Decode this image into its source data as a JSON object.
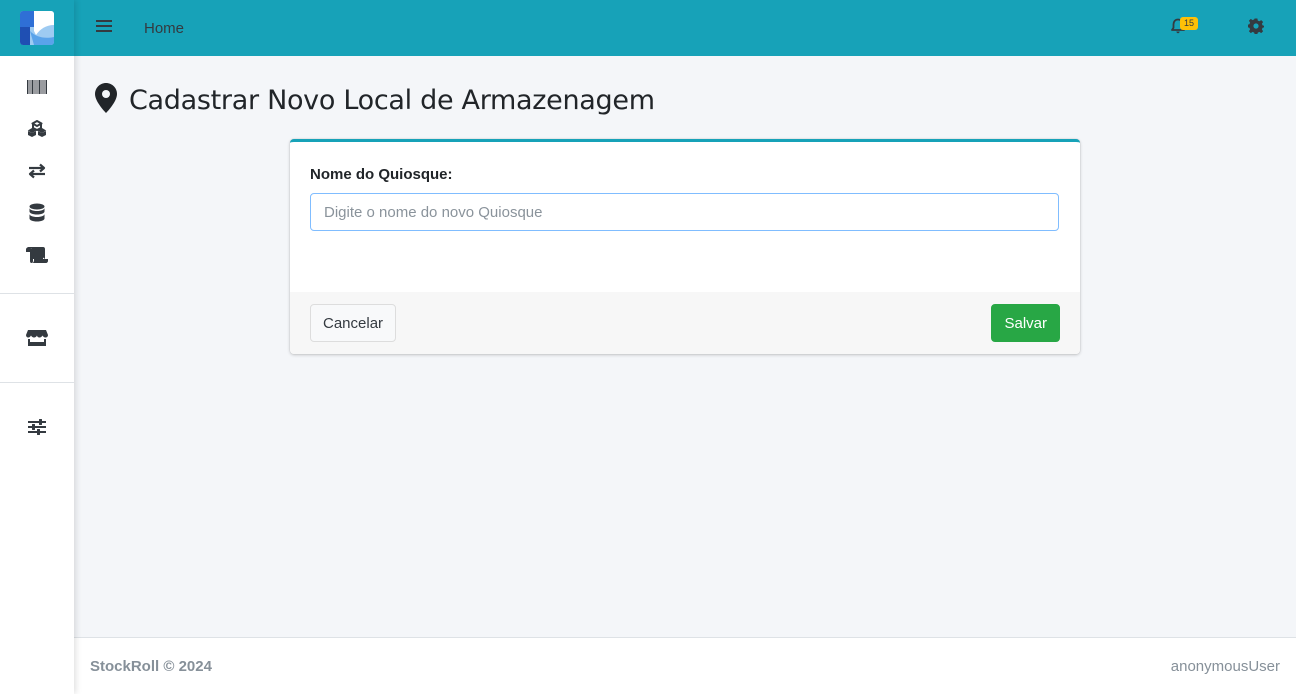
{
  "colors": {
    "primary": "#17a2b8",
    "success": "#28a745",
    "warning": "#ffc107",
    "dark": "#343a40"
  },
  "sidebar": {
    "logo_icon": "app-logo",
    "items": [
      {
        "icon": "barcode-icon"
      },
      {
        "icon": "cubes-icon"
      },
      {
        "icon": "exchange-icon"
      },
      {
        "icon": "database-icon"
      },
      {
        "icon": "scroll-icon"
      },
      {
        "icon": "store-icon"
      },
      {
        "icon": "sliders-icon"
      }
    ]
  },
  "topbar": {
    "menu_icon": "hamburger-icon",
    "home_label": "Home",
    "notifications_count": "15",
    "settings_icon": "gear-icon"
  },
  "page": {
    "title": "Cadastrar Novo Local de Armazenagem",
    "title_icon": "map-marker-icon"
  },
  "form": {
    "field_label": "Nome do Quiosque:",
    "field_value": "",
    "field_placeholder": "Digite o nome do novo Quiosque",
    "cancel_label": "Cancelar",
    "save_label": "Salvar"
  },
  "footer": {
    "copyright": "StockRoll © 2024",
    "user": "anonymousUser"
  }
}
